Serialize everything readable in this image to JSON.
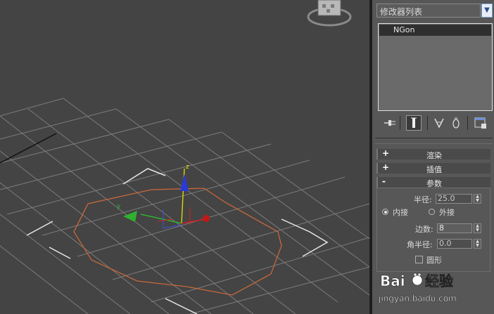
{
  "viewport": {
    "axis_z_label": "z",
    "axis_y_label": "y"
  },
  "modifier_list": {
    "label": "修改器列表"
  },
  "stack": {
    "items": [
      "NGon"
    ]
  },
  "rollouts": {
    "render": {
      "sign": "+",
      "title": "渲染"
    },
    "interp": {
      "sign": "+",
      "title": "插值"
    },
    "params": {
      "sign": "-",
      "title": "参数"
    }
  },
  "params": {
    "radius_label": "半径:",
    "radius_value": "25.0",
    "inscribed_label": "内接",
    "circumscribed_label": "外接",
    "sides_label": "边数:",
    "sides_value": "8",
    "corner_radius_label": "角半径:",
    "corner_radius_value": "0.0",
    "circular_label": "圆形"
  },
  "watermark": {
    "brand_text": "Bai",
    "brand_text2": "经验",
    "url": "jingyan.baidu.com"
  },
  "colors": {
    "viewport_bg": "#444444",
    "panel_bg": "#575757",
    "shape_color": "#c8683a",
    "axis_x": "#d22020",
    "axis_y": "#2fb02f",
    "axis_z": "#2a3ad8"
  },
  "icons": [
    "viewcube-icon",
    "pin-stack-icon",
    "show-end-result-icon",
    "make-unique-icon",
    "remove-modifier-icon",
    "configure-sets-icon",
    "dropdown-arrow-icon"
  ]
}
